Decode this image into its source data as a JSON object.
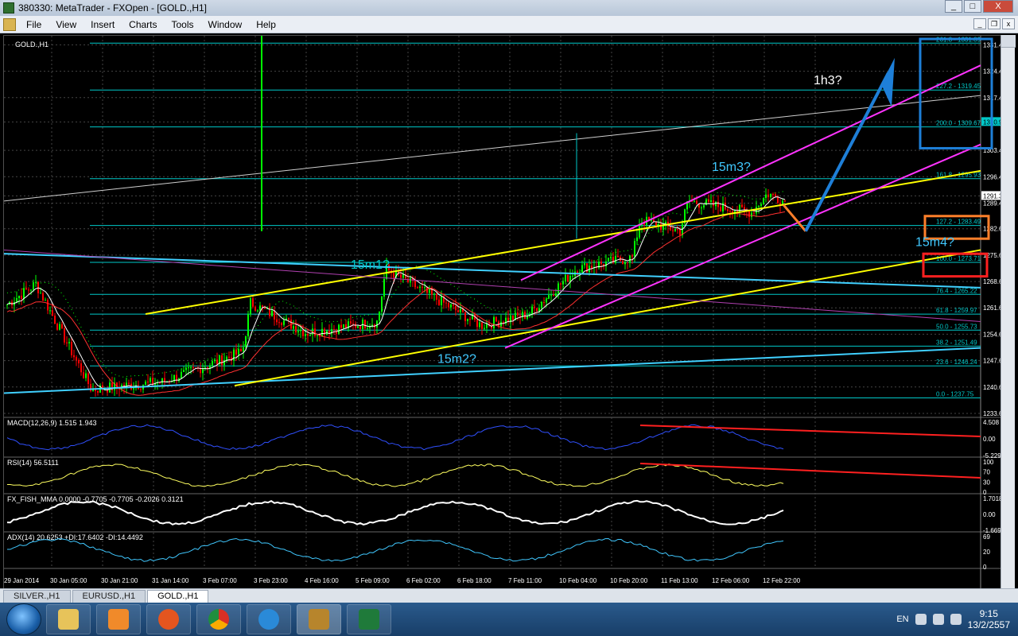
{
  "window": {
    "title": "380330: MetaTrader - FXOpen - [GOLD.,H1]",
    "min": "_",
    "max": "□",
    "close": "X"
  },
  "menu": [
    "File",
    "View",
    "Insert",
    "Charts",
    "Tools",
    "Window",
    "Help"
  ],
  "chart": {
    "symbol_label": "GOLD.,H1",
    "price_axis": [
      "1331.44",
      "1324.44",
      "1317.44",
      "1310.98",
      "1303.44",
      "1296.44",
      "1291.35",
      "1289.44",
      "1282.64",
      "1275.64",
      "1268.64",
      "1261.64",
      "1254.64",
      "1247.64",
      "1240.64",
      "1233.64"
    ],
    "current_price": "1291.35",
    "marked_price": "1310.98",
    "time_axis": [
      "29 Jan 2014",
      "30 Jan 05:00",
      "30 Jan 21:00",
      "31 Jan 14:00",
      "3 Feb 07:00",
      "3 Feb 23:00",
      "4 Feb 16:00",
      "5 Feb 09:00",
      "6 Feb 02:00",
      "6 Feb 18:00",
      "7 Feb 11:00",
      "10 Feb 04:00",
      "10 Feb 20:00",
      "11 Feb 13:00",
      "12 Feb 06:00",
      "12 Feb 22:00"
    ],
    "fib_levels": [
      "261.8 - 1331.89",
      "227.2 - 1319.45",
      "200.0 - 1309.67",
      "161.8 - 1295.93",
      "127.2 - 1283.49",
      "100.0 - 1273.71",
      "76.4 - 1265.22",
      "61.8 - 1259.97",
      "50.0 - 1255.73",
      "38.2 - 1251.49",
      "23.6 - 1246.24",
      "0.0 - 1237.75"
    ],
    "annotations": [
      "1h3?",
      "15m3?",
      "15m4?",
      "15m1?",
      "15m2?"
    ],
    "colors": {
      "background": "#000000",
      "bull_candle": "#00ff00",
      "bear_candle": "#ff0000",
      "fib": "#00c8c8",
      "channel": "#ff33ff",
      "trendline": "#ffff00",
      "box_blue": "#1e7fd8",
      "box_orange": "#ff7f2a",
      "box_red": "#ff2020"
    }
  },
  "indicators": {
    "macd": {
      "label": "MACD(12,26,9) 1.515 1.943",
      "levels": [
        "4.508",
        "0.00",
        "-5.229"
      ]
    },
    "rsi": {
      "label": "RSI(14) 56.5111",
      "levels": [
        "100",
        "70",
        "30",
        "0"
      ]
    },
    "fisher": {
      "label": "FX_FISH_MMA 0.0000 -0.7705 -0.7705 -0.2026 0.3121",
      "levels": [
        "1.7018",
        "0.00",
        "-1.6698"
      ]
    },
    "adx": {
      "label": "ADX(14) 20.6253 +DI:17.6402 -DI:14.4492",
      "levels": [
        "69",
        "20",
        "0"
      ]
    }
  },
  "tabs": [
    "SILVER.,H1",
    "EURUSD.,H1",
    "GOLD.,H1"
  ],
  "active_tab": "GOLD.,H1",
  "taskbar": {
    "apps": [
      "explorer-icon",
      "media-player-icon",
      "firefox-icon",
      "chrome-icon",
      "ie-icon",
      "metatrader-icon",
      "excel-icon"
    ],
    "active_app": "metatrader-icon"
  },
  "tray": {
    "lang": "EN",
    "time": "9:15",
    "date": "13/2/2557"
  }
}
